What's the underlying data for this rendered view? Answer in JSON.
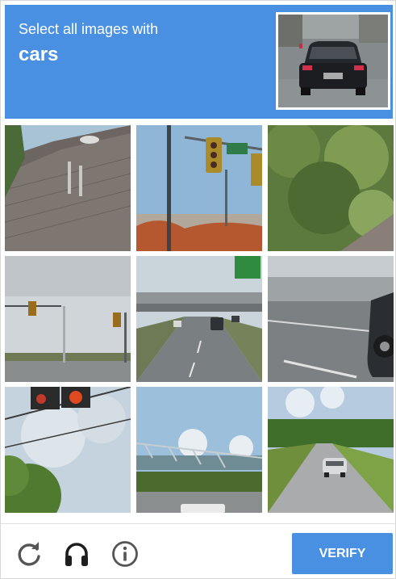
{
  "challenge": {
    "instruction_prefix": "Select all images with",
    "target_object": "cars"
  },
  "buttons": {
    "verify_label": "VERIFY"
  },
  "icons": {
    "reload": "reload-icon",
    "audio": "headphones-icon",
    "help": "info-icon"
  },
  "colors": {
    "accent": "#4a90e2"
  }
}
